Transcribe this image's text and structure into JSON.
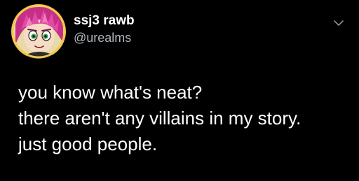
{
  "tweet": {
    "author": {
      "display_name": "ssj3 rawb",
      "handle": "@urealms",
      "avatar_icon": "avatar-cartoon-character"
    },
    "menu_icon": "chevron-down-icon",
    "lines": [
      "you know what's neat?",
      "there aren't any villains in my story.",
      "just good people."
    ]
  },
  "colors": {
    "background": "#000000",
    "text_primary": "#ffffff",
    "text_secondary": "#b3b8bd",
    "avatar_hair": "#d93a9c",
    "avatar_ring": "#f2c94c"
  }
}
